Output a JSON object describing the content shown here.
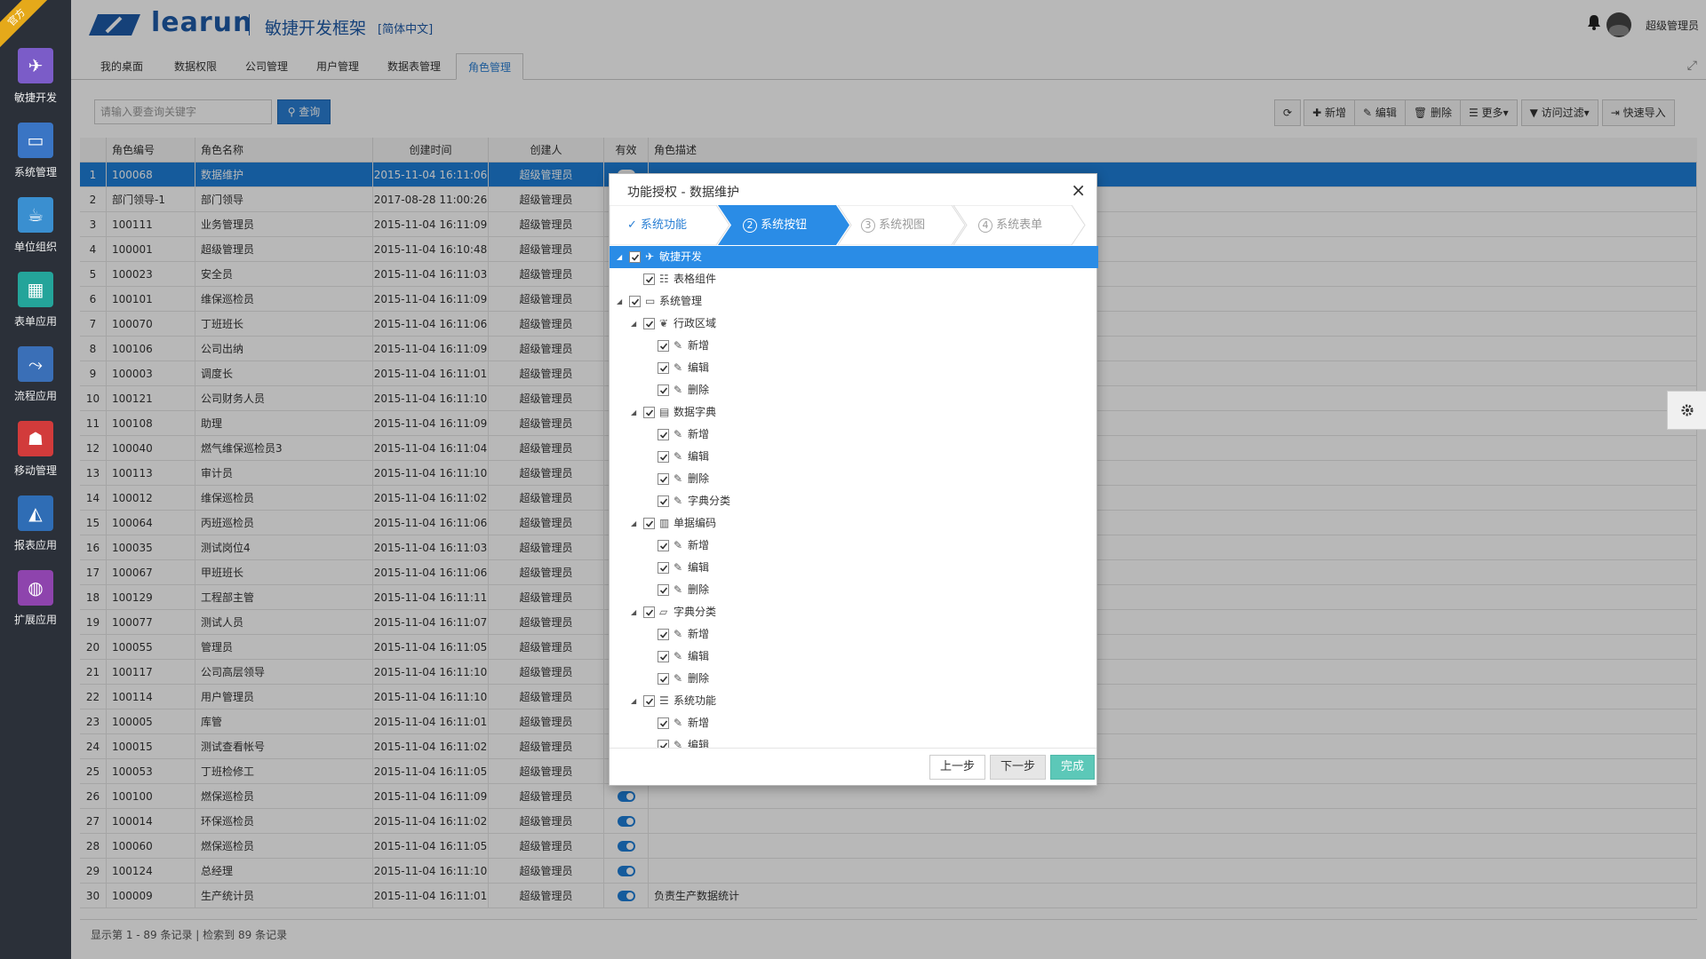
{
  "ribbon": "官方",
  "sidebar": {
    "items": [
      {
        "label": "敏捷开发",
        "icon": "paper-plane-icon",
        "color": "#7b5cc8"
      },
      {
        "label": "系统管理",
        "icon": "monitor-icon",
        "color": "#3a75c4"
      },
      {
        "label": "单位组织",
        "icon": "coffee-icon",
        "color": "#3a8fd0"
      },
      {
        "label": "表单应用",
        "icon": "table-icon",
        "color": "#24a49a"
      },
      {
        "label": "流程应用",
        "icon": "share-icon",
        "color": "#3a6fb7"
      },
      {
        "label": "移动管理",
        "icon": "android-icon",
        "color": "#d23b3b"
      },
      {
        "label": "报表应用",
        "icon": "chart-area-icon",
        "color": "#2f6db5"
      },
      {
        "label": "扩展应用",
        "icon": "globe-icon",
        "color": "#8e44ad"
      }
    ]
  },
  "header": {
    "brand": "learun",
    "title": "敏捷开发框架",
    "lang": "[简体中文]",
    "user": "超级管理员"
  },
  "tabs": [
    "我的桌面",
    "数据权限",
    "公司管理",
    "用户管理",
    "数据表管理",
    "角色管理"
  ],
  "toolbar": {
    "search_placeholder": "请输入要查询关键字",
    "search_button": "查询",
    "refresh": "",
    "add": "新增",
    "edit": "编辑",
    "delete": "删除",
    "more": "更多",
    "filter": "访问过滤",
    "quick_import": "快速导入"
  },
  "grid": {
    "headers": [
      "角色编号",
      "角色名称",
      "创建时间",
      "创建人",
      "有效",
      "角色描述"
    ],
    "rows": [
      [
        "1",
        "100068",
        "数据维护",
        "2015-11-04 16:11:06",
        "超级管理员",
        ""
      ],
      [
        "2",
        "部门领导-1",
        "部门领导",
        "2017-08-28 11:00:26",
        "超级管理员",
        ""
      ],
      [
        "3",
        "100111",
        "业务管理员",
        "2015-11-04 16:11:09",
        "超级管理员",
        ""
      ],
      [
        "4",
        "100001",
        "超级管理员",
        "2015-11-04 16:10:48",
        "超级管理员",
        ""
      ],
      [
        "5",
        "100023",
        "安全员",
        "2015-11-04 16:11:03",
        "超级管理员",
        ""
      ],
      [
        "6",
        "100101",
        "维保巡检员",
        "2015-11-04 16:11:09",
        "超级管理员",
        ""
      ],
      [
        "7",
        "100070",
        "丁班班长",
        "2015-11-04 16:11:06",
        "超级管理员",
        ""
      ],
      [
        "8",
        "100106",
        "公司出纳",
        "2015-11-04 16:11:09",
        "超级管理员",
        ""
      ],
      [
        "9",
        "100003",
        "调度长",
        "2015-11-04 16:11:01",
        "超级管理员",
        ""
      ],
      [
        "10",
        "100121",
        "公司财务人员",
        "2015-11-04 16:11:10",
        "超级管理员",
        ""
      ],
      [
        "11",
        "100108",
        "助理",
        "2015-11-04 16:11:09",
        "超级管理员",
        ""
      ],
      [
        "12",
        "100040",
        "燃气维保巡检员3",
        "2015-11-04 16:11:04",
        "超级管理员",
        ""
      ],
      [
        "13",
        "100113",
        "审计员",
        "2015-11-04 16:11:10",
        "超级管理员",
        ""
      ],
      [
        "14",
        "100012",
        "维保巡检员",
        "2015-11-04 16:11:02",
        "超级管理员",
        ""
      ],
      [
        "15",
        "100064",
        "丙班巡检员",
        "2015-11-04 16:11:06",
        "超级管理员",
        ""
      ],
      [
        "16",
        "100035",
        "测试岗位4",
        "2015-11-04 16:11:03",
        "超级管理员",
        ""
      ],
      [
        "17",
        "100067",
        "甲班班长",
        "2015-11-04 16:11:06",
        "超级管理员",
        ""
      ],
      [
        "18",
        "100129",
        "工程部主管",
        "2015-11-04 16:11:11",
        "超级管理员",
        ""
      ],
      [
        "19",
        "100077",
        "测试人员",
        "2015-11-04 16:11:07",
        "超级管理员",
        ""
      ],
      [
        "20",
        "100055",
        "管理员",
        "2015-11-04 16:11:05",
        "超级管理员",
        ""
      ],
      [
        "21",
        "100117",
        "公司高层领导",
        "2015-11-04 16:11:10",
        "超级管理员",
        ""
      ],
      [
        "22",
        "100114",
        "用户管理员",
        "2015-11-04 16:11:10",
        "超级管理员",
        ""
      ],
      [
        "23",
        "100005",
        "库管",
        "2015-11-04 16:11:01",
        "超级管理员",
        ""
      ],
      [
        "24",
        "100015",
        "测试查看帐号",
        "2015-11-04 16:11:02",
        "超级管理员",
        ""
      ],
      [
        "25",
        "100053",
        "丁班检修工",
        "2015-11-04 16:11:05",
        "超级管理员",
        ""
      ],
      [
        "26",
        "100100",
        "燃保巡检员",
        "2015-11-04 16:11:09",
        "超级管理员",
        ""
      ],
      [
        "27",
        "100014",
        "环保巡检员",
        "2015-11-04 16:11:02",
        "超级管理员",
        ""
      ],
      [
        "28",
        "100060",
        "燃保巡检员",
        "2015-11-04 16:11:05",
        "超级管理员",
        ""
      ],
      [
        "29",
        "100124",
        "总经理",
        "2015-11-04 16:11:10",
        "超级管理员",
        ""
      ],
      [
        "30",
        "100009",
        "生产统计员",
        "2015-11-04 16:11:01",
        "超级管理员",
        "负责生产数据统计"
      ]
    ],
    "footer": "显示第 1 - 89 条记录 | 检索到 89 条记录"
  },
  "dialog": {
    "title": "功能授权 - 数据维护",
    "steps": [
      "系统功能",
      "系统按钮",
      "系统视图",
      "系统表单"
    ],
    "step_numbers": [
      "",
      "2",
      "3",
      "4"
    ],
    "tree": [
      {
        "label": "敏捷开发",
        "level": 0,
        "icon": "paper-plane-icon",
        "expanded": true
      },
      {
        "label": "表格组件",
        "level": 1,
        "icon": "list-icon",
        "expanded": false
      },
      {
        "label": "系统管理",
        "level": 0,
        "icon": "monitor-icon",
        "expanded": true
      },
      {
        "label": "行政区域",
        "level": 1,
        "icon": "leaf-icon",
        "expanded": true
      },
      {
        "label": "新增",
        "level": 2,
        "icon": "wrench-icon",
        "expanded": false
      },
      {
        "label": "编辑",
        "level": 2,
        "icon": "wrench-icon",
        "expanded": false
      },
      {
        "label": "删除",
        "level": 2,
        "icon": "wrench-icon",
        "expanded": false
      },
      {
        "label": "数据字典",
        "level": 1,
        "icon": "book-icon",
        "expanded": true
      },
      {
        "label": "新增",
        "level": 2,
        "icon": "wrench-icon",
        "expanded": false
      },
      {
        "label": "编辑",
        "level": 2,
        "icon": "wrench-icon",
        "expanded": false
      },
      {
        "label": "删除",
        "level": 2,
        "icon": "wrench-icon",
        "expanded": false
      },
      {
        "label": "字典分类",
        "level": 2,
        "icon": "wrench-icon",
        "expanded": false
      },
      {
        "label": "单据编码",
        "level": 1,
        "icon": "barcode-icon",
        "expanded": true
      },
      {
        "label": "新增",
        "level": 2,
        "icon": "wrench-icon",
        "expanded": false
      },
      {
        "label": "编辑",
        "level": 2,
        "icon": "wrench-icon",
        "expanded": false
      },
      {
        "label": "删除",
        "level": 2,
        "icon": "wrench-icon",
        "expanded": false
      },
      {
        "label": "字典分类",
        "level": 1,
        "icon": "folder-open-icon",
        "expanded": true
      },
      {
        "label": "新增",
        "level": 2,
        "icon": "wrench-icon",
        "expanded": false
      },
      {
        "label": "编辑",
        "level": 2,
        "icon": "wrench-icon",
        "expanded": false
      },
      {
        "label": "删除",
        "level": 2,
        "icon": "wrench-icon",
        "expanded": false
      },
      {
        "label": "系统功能",
        "level": 1,
        "icon": "menu-icon",
        "expanded": true
      },
      {
        "label": "新增",
        "level": 2,
        "icon": "wrench-icon",
        "expanded": false
      },
      {
        "label": "编辑",
        "level": 2,
        "icon": "wrench-icon",
        "expanded": false
      }
    ],
    "buttons": {
      "prev": "上一步",
      "next": "下一步",
      "finish": "完成"
    }
  },
  "colors": {
    "primary": "#2a7fd4",
    "sidebar": "#2b3039",
    "finish": "#5cc8b8",
    "ribbon": "#e5a91a"
  }
}
